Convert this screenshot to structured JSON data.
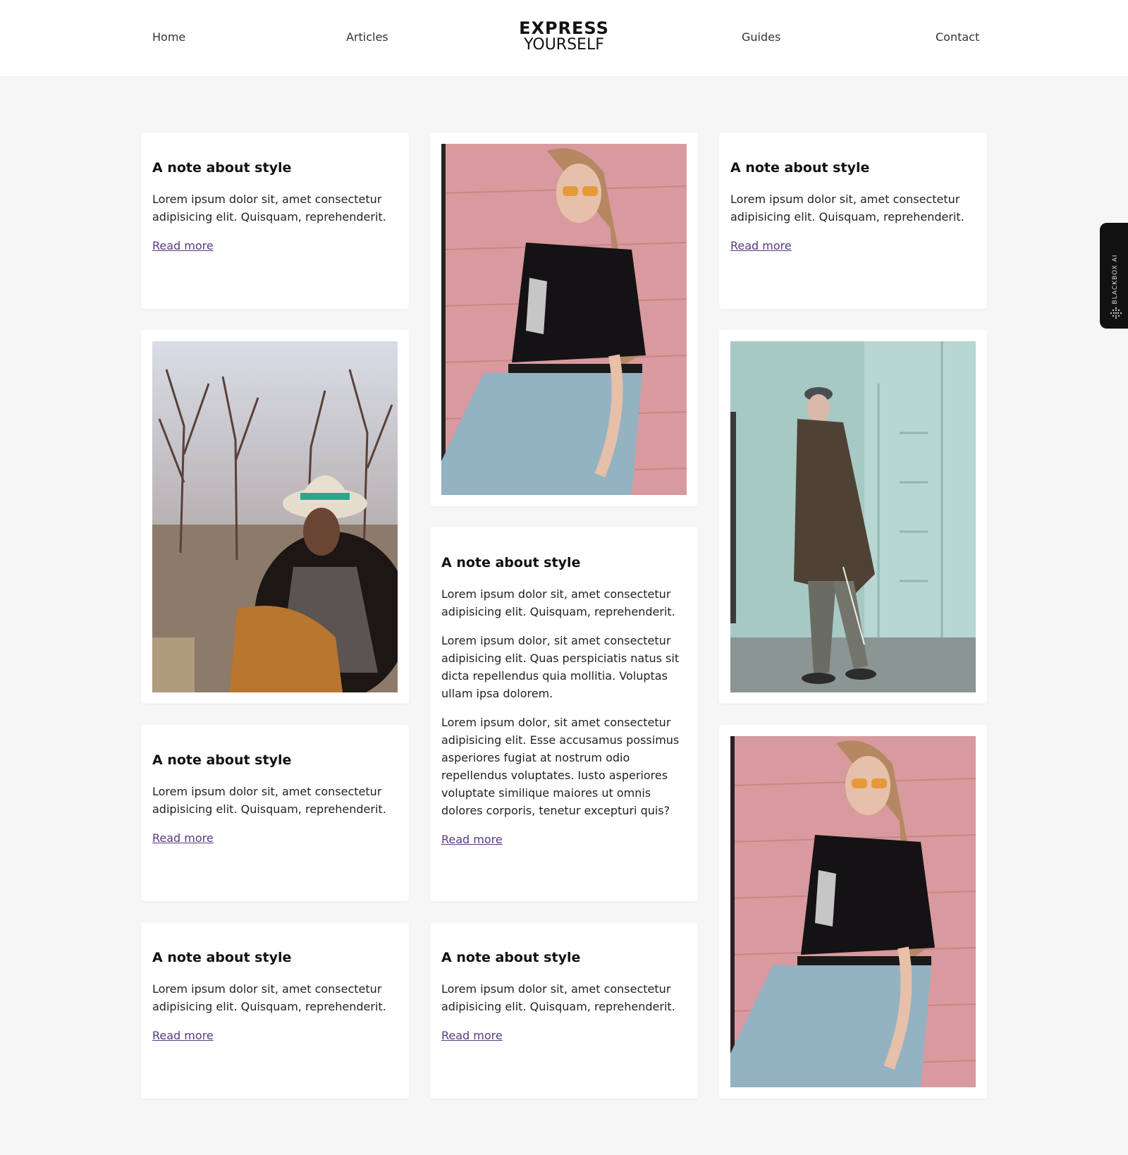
{
  "nav": {
    "home": "Home",
    "articles": "Articles",
    "guides": "Guides",
    "contact": "Contact"
  },
  "logo": {
    "top": "EXPRESS",
    "bottom": "YOURSELF"
  },
  "cards": {
    "c1": {
      "title": "A note about style",
      "p1": "Lorem ipsum dolor sit, amet consectetur adipisicing elit. Quisquam, reprehenderit.",
      "link": "Read more"
    },
    "c2": {
      "title": "A note about style",
      "p1": "Lorem ipsum dolor sit, amet consectetur adipisicing elit. Quisquam, reprehenderit.",
      "link": "Read more"
    },
    "c3": {
      "title": "A note about style",
      "p1": "Lorem ipsum dolor sit, amet consectetur adipisicing elit. Quisquam, reprehenderit.",
      "p2": "Lorem ipsum dolor, sit amet consectetur adipisicing elit. Quas perspiciatis natus sit dicta repellendus quia mollitia. Voluptas ullam ipsa dolorem.",
      "p3": "Lorem ipsum dolor, sit amet consectetur adipisicing elit. Esse accusamus possimus asperiores fugiat at nostrum odio repellendus voluptates. Iusto asperiores voluptate similique maiores ut omnis dolores corporis, tenetur excepturi quis?",
      "link": "Read more"
    },
    "c4": {
      "title": "A note about style",
      "p1": "Lorem ipsum dolor sit, amet consectetur adipisicing elit. Quisquam, reprehenderit.",
      "link": "Read more"
    },
    "c5": {
      "title": "A note about style",
      "p1": "Lorem ipsum dolor sit, amet consectetur adipisicing elit. Quisquam, reprehenderit.",
      "link": "Read more"
    },
    "c6": {
      "title": "A note about style",
      "p1": "Lorem ipsum dolor sit, amet consectetur adipisicing elit. Quisquam, reprehenderit.",
      "link": "Read more"
    }
  },
  "widget": {
    "label": "BLACKBOX AI",
    "icon": "dots-grid-icon"
  },
  "colors": {
    "link": "#5a3a80",
    "page_bg": "#f6f6f6",
    "card_bg": "#ffffff",
    "pink_wall": "#d89a9e",
    "mint_wall": "#a7c9c4"
  }
}
